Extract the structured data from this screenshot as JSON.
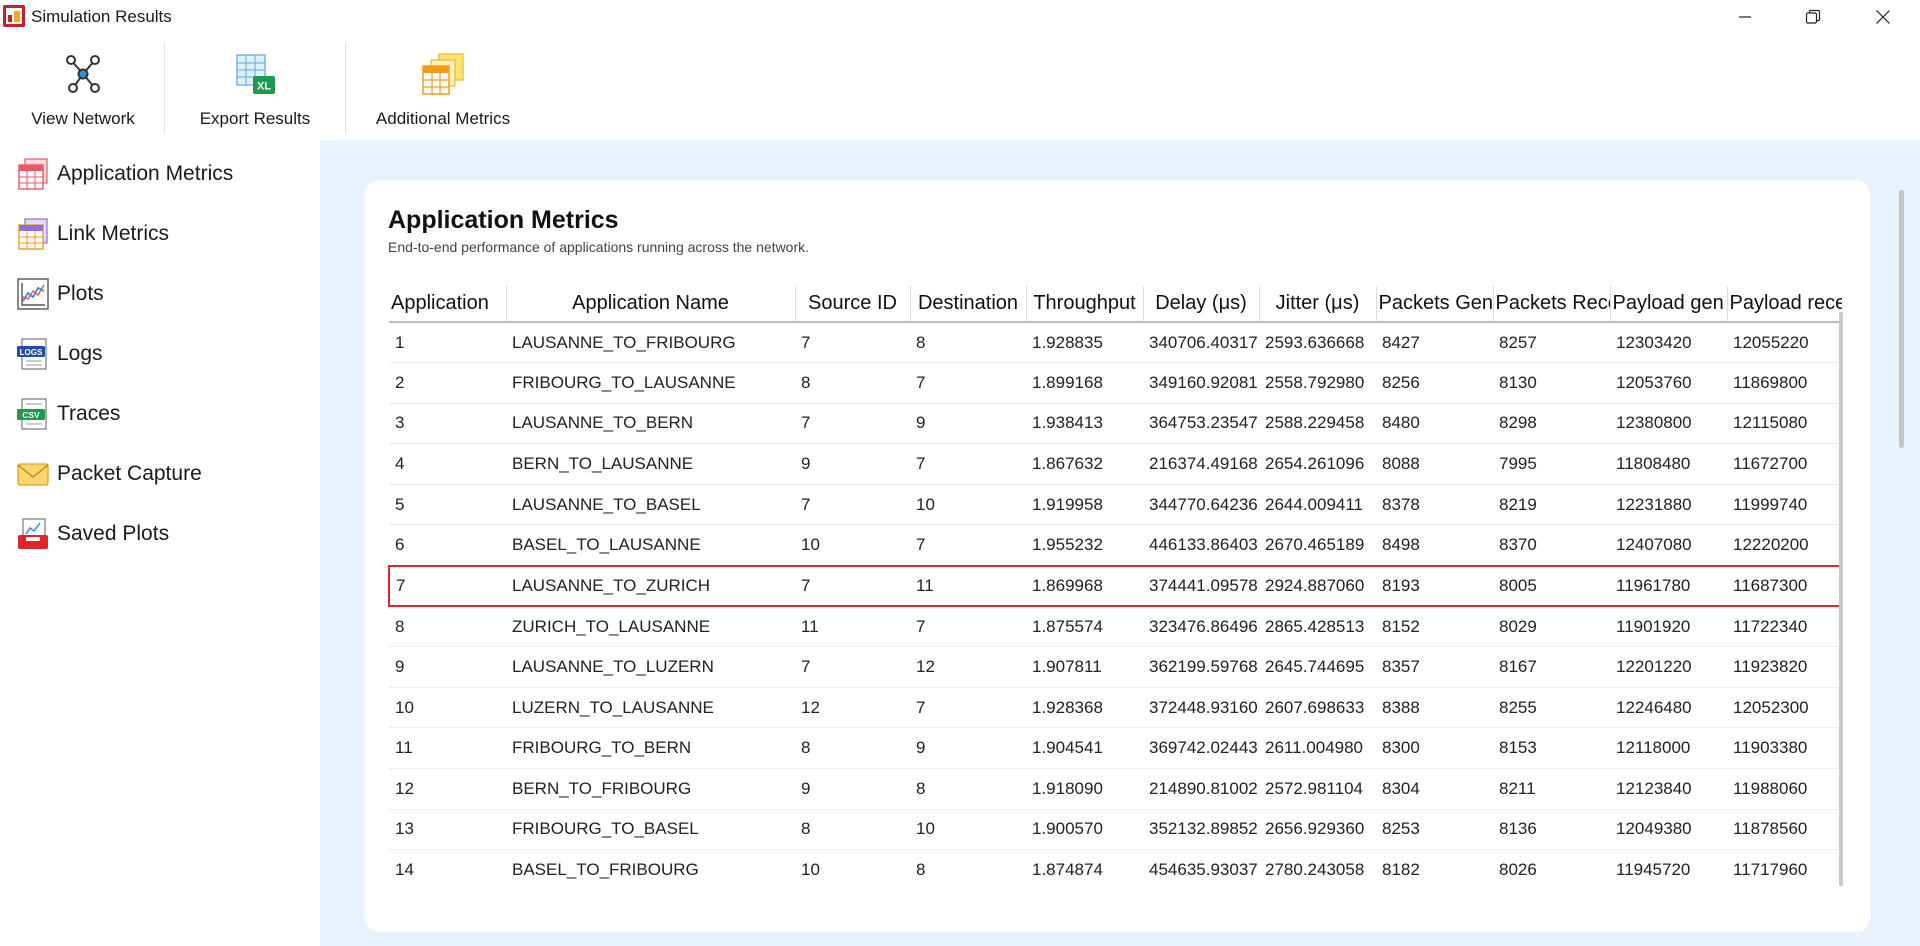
{
  "window": {
    "title": "Simulation Results",
    "icon": "netsim-app-icon",
    "controls": [
      "minimize-icon",
      "maximize-icon",
      "close-icon"
    ]
  },
  "toolbar": {
    "view_network": "View Network",
    "export_results": "Export Results",
    "additional_metrics": "Additional Metrics"
  },
  "sidebar": {
    "items": [
      {
        "label": "Application Metrics",
        "icon": "table-metrics-icon"
      },
      {
        "label": "Link Metrics",
        "icon": "link-metrics-icon"
      },
      {
        "label": "Plots",
        "icon": "plot-chart-icon"
      },
      {
        "label": "Logs",
        "icon": "logs-icon"
      },
      {
        "label": "Traces",
        "icon": "csv-icon"
      },
      {
        "label": "Packet Capture",
        "icon": "envelope-icon"
      },
      {
        "label": "Saved Plots",
        "icon": "saved-plots-icon"
      }
    ]
  },
  "card": {
    "title": "Application Metrics",
    "subtitle": "End-to-end performance of applications running across the network."
  },
  "table": {
    "headers": [
      "Application",
      "Application Name",
      "Source ID",
      "Destination",
      "Throughput",
      "Delay (μs)",
      "Jitter (μs)",
      "Packets Gen",
      "Packets Rece",
      "Payload gen",
      "Payload rece"
    ],
    "highlighted_row": 6,
    "rows": [
      [
        "1",
        "LAUSANNE_TO_FRIBOURG",
        "7",
        "8",
        "1.928835",
        "340706.40317",
        "2593.636668",
        "8427",
        "8257",
        "12303420",
        "12055220"
      ],
      [
        "2",
        "FRIBOURG_TO_LAUSANNE",
        "8",
        "7",
        "1.899168",
        "349160.92081",
        "2558.792980",
        "8256",
        "8130",
        "12053760",
        "11869800"
      ],
      [
        "3",
        "LAUSANNE_TO_BERN",
        "7",
        "9",
        "1.938413",
        "364753.23547",
        "2588.229458",
        "8480",
        "8298",
        "12380800",
        "12115080"
      ],
      [
        "4",
        "BERN_TO_LAUSANNE",
        "9",
        "7",
        "1.867632",
        "216374.49168",
        "2654.261096",
        "8088",
        "7995",
        "11808480",
        "11672700"
      ],
      [
        "5",
        "LAUSANNE_TO_BASEL",
        "7",
        "10",
        "1.919958",
        "344770.64236",
        "2644.009411",
        "8378",
        "8219",
        "12231880",
        "11999740"
      ],
      [
        "6",
        "BASEL_TO_LAUSANNE",
        "10",
        "7",
        "1.955232",
        "446133.86403",
        "2670.465189",
        "8498",
        "8370",
        "12407080",
        "12220200"
      ],
      [
        "7",
        "LAUSANNE_TO_ZURICH",
        "7",
        "11",
        "1.869968",
        "374441.09578",
        "2924.887060",
        "8193",
        "8005",
        "11961780",
        "11687300"
      ],
      [
        "8",
        "ZURICH_TO_LAUSANNE",
        "11",
        "7",
        "1.875574",
        "323476.86496",
        "2865.428513",
        "8152",
        "8029",
        "11901920",
        "11722340"
      ],
      [
        "9",
        "LAUSANNE_TO_LUZERN",
        "7",
        "12",
        "1.907811",
        "362199.59768",
        "2645.744695",
        "8357",
        "8167",
        "12201220",
        "11923820"
      ],
      [
        "10",
        "LUZERN_TO_LAUSANNE",
        "12",
        "7",
        "1.928368",
        "372448.93160",
        "2607.698633",
        "8388",
        "8255",
        "12246480",
        "12052300"
      ],
      [
        "11",
        "FRIBOURG_TO_BERN",
        "8",
        "9",
        "1.904541",
        "369742.02443",
        "2611.004980",
        "8300",
        "8153",
        "12118000",
        "11903380"
      ],
      [
        "12",
        "BERN_TO_FRIBOURG",
        "9",
        "8",
        "1.918090",
        "214890.81002",
        "2572.981104",
        "8304",
        "8211",
        "12123840",
        "11988060"
      ],
      [
        "13",
        "FRIBOURG_TO_BASEL",
        "8",
        "10",
        "1.900570",
        "352132.89852",
        "2656.929360",
        "8253",
        "8136",
        "12049380",
        "11878560"
      ],
      [
        "14",
        "BASEL_TO_FRIBOURG",
        "10",
        "8",
        "1.874874",
        "454635.93037",
        "2780.243058",
        "8182",
        "8026",
        "11945720",
        "11717960"
      ]
    ]
  },
  "colors": {
    "highlight_border": "#e0252b",
    "panel_background": "#e6f3fc",
    "card_background": "#ffffff"
  }
}
